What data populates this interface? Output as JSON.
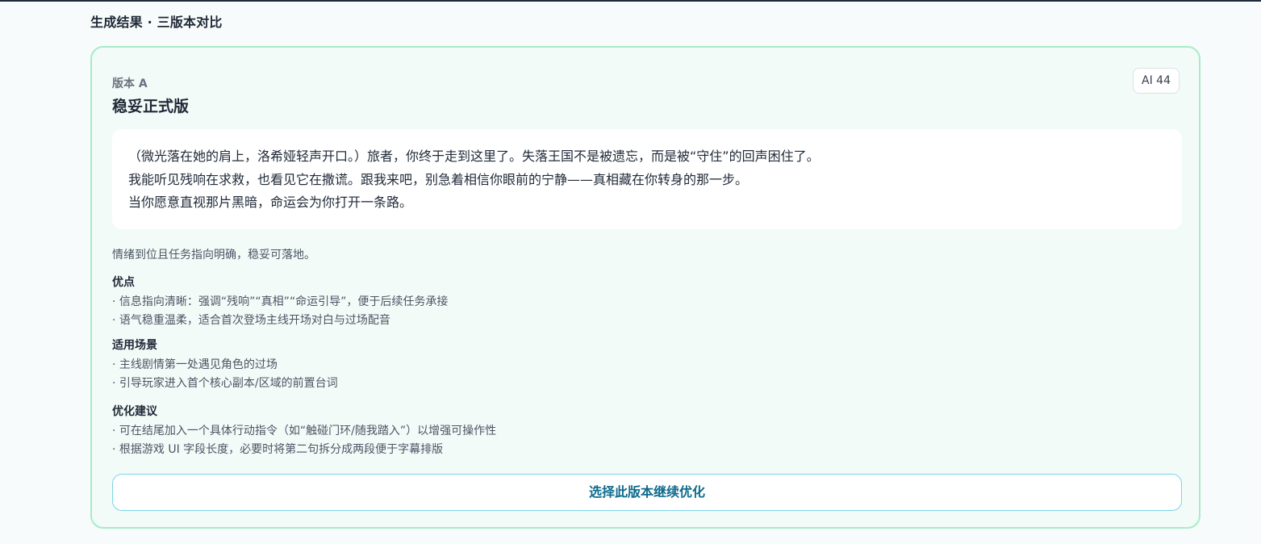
{
  "section_title": "生成结果 · 三版本对比",
  "card": {
    "version_label": "版本 A",
    "version_name": "稳妥正式版",
    "ai_badge": "AI 44",
    "dialog_lines": [
      "（微光落在她的肩上，洛希娅轻声开口。）旅者，你终于走到这里了。失落王国不是被遗忘，而是被“守住”的回声困住了。",
      "我能听见残响在求救，也看见它在撒谎。跟我来吧，别急着相信你眼前的宁静——真相藏在你转身的那一步。",
      "当你愿意直视那片黑暗，命运会为你打开一条路。"
    ],
    "summary": "情绪到位且任务指向明确，稳妥可落地。",
    "pros": {
      "title": "优点",
      "items": [
        "· 信息指向清晰：强调“残响”“真相”“命运引导”，便于后续任务承接",
        "· 语气稳重温柔，适合首次登场主线开场对白与过场配音"
      ]
    },
    "scenarios": {
      "title": "适用场景",
      "items": [
        "· 主线剧情第一处遇见角色的过场",
        "· 引导玩家进入首个核心副本/区域的前置台词"
      ]
    },
    "suggestions": {
      "title": "优化建议",
      "items": [
        "· 可在结尾加入一个具体行动指令（如“触碰门环/随我踏入”）以增强可操作性",
        "· 根据游戏 UI 字段长度，必要时将第二句拆分成两段便于字幕排版"
      ]
    },
    "select_button": "选择此版本继续优化"
  },
  "colors": {
    "card_border": "#a7ecc7",
    "card_bg": "#f3fbf8",
    "button_border": "#7dd3e8",
    "button_text": "#0e6b8c"
  }
}
